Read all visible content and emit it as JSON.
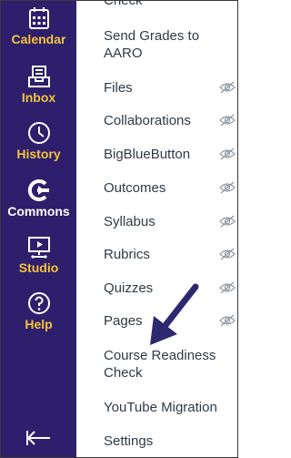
{
  "global_nav": {
    "items": [
      {
        "label": "Calendar",
        "icon": "calendar-icon"
      },
      {
        "label": "Inbox",
        "icon": "inbox-icon"
      },
      {
        "label": "History",
        "icon": "clock-icon"
      },
      {
        "label": "Commons",
        "icon": "commons-icon"
      },
      {
        "label": "Studio",
        "icon": "studio-icon"
      },
      {
        "label": "Help",
        "icon": "help-icon"
      }
    ],
    "collapse_icon": "collapse-icon"
  },
  "course_nav": {
    "partial_top": "Check",
    "items": [
      {
        "label": "Send Grades to AARO",
        "hidden": false
      },
      {
        "label": "Files",
        "hidden": true
      },
      {
        "label": "Collaborations",
        "hidden": true
      },
      {
        "label": "BigBlueButton",
        "hidden": true
      },
      {
        "label": "Outcomes",
        "hidden": true
      },
      {
        "label": "Syllabus",
        "hidden": true
      },
      {
        "label": "Rubrics",
        "hidden": true
      },
      {
        "label": "Quizzes",
        "hidden": true
      },
      {
        "label": "Pages",
        "hidden": true
      },
      {
        "label": "Course Readiness Check",
        "hidden": false
      },
      {
        "label": "YouTube Migration",
        "hidden": false
      },
      {
        "label": "Settings",
        "hidden": false
      }
    ]
  },
  "colors": {
    "nav_bg": "#2d1f6b",
    "nav_label": "#f5c33b",
    "arrow": "#2d2970"
  }
}
